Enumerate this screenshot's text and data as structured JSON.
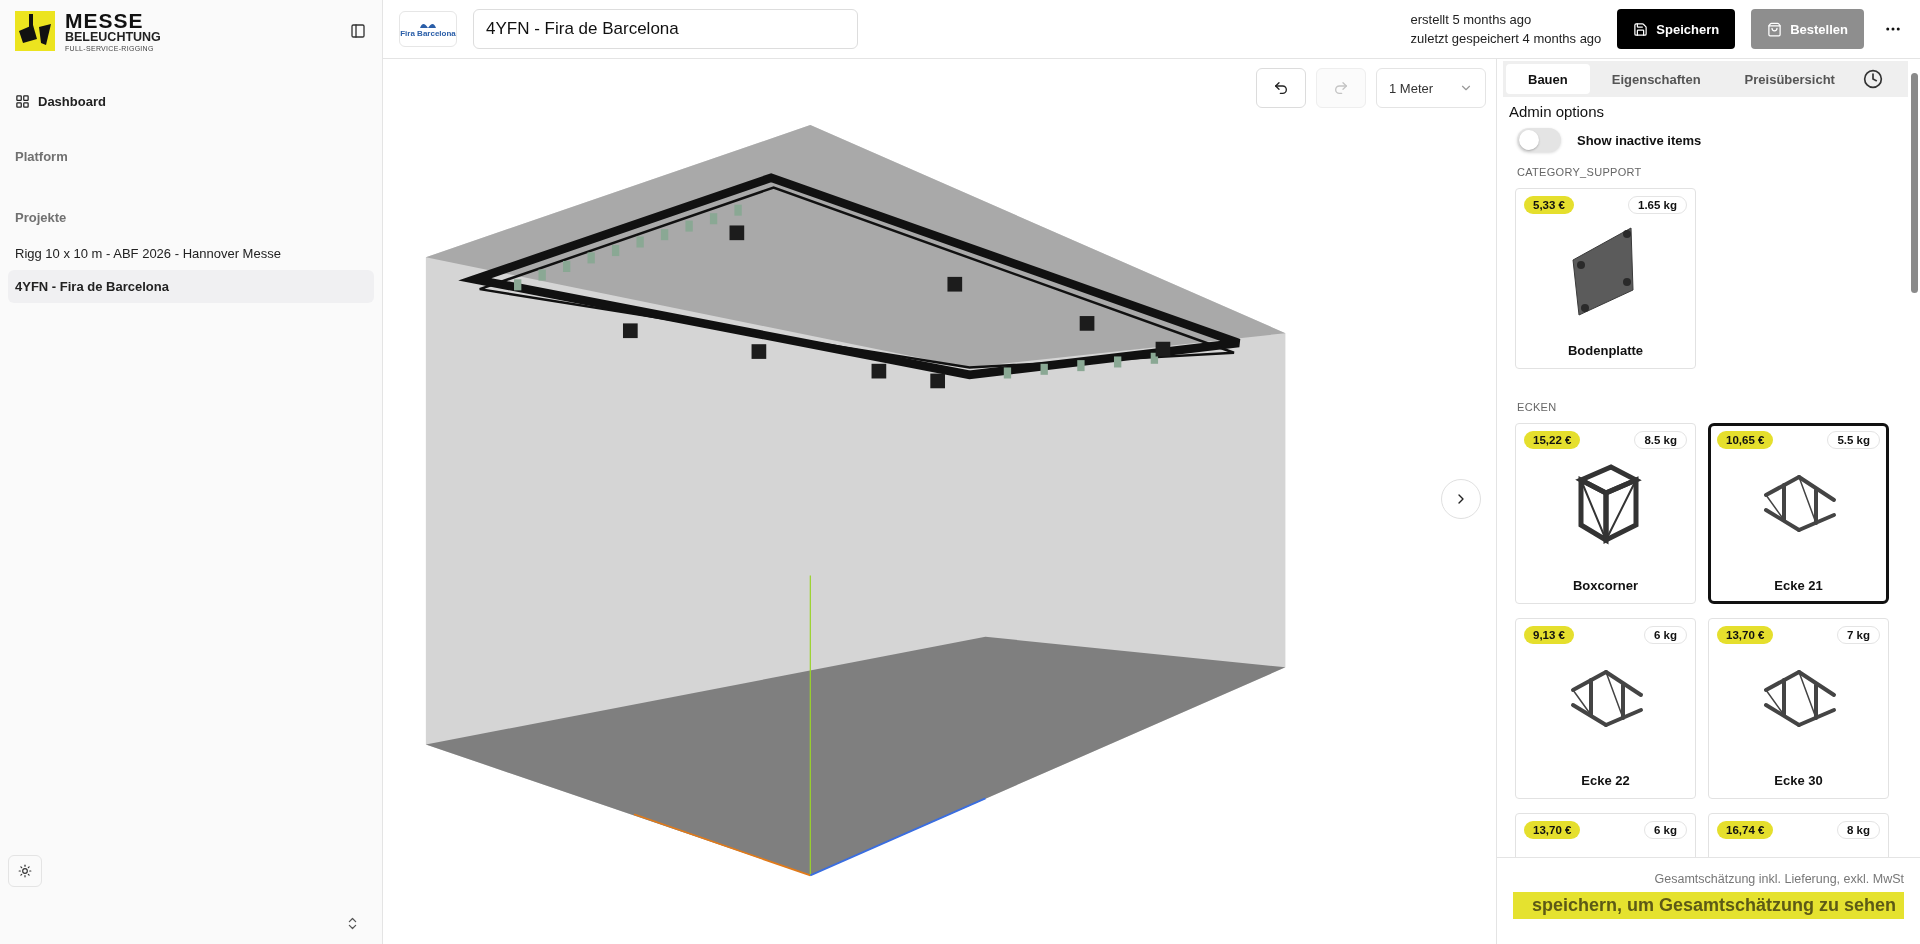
{
  "sidebar": {
    "logo": {
      "title": "MESSE",
      "subtitle": "BELEUCHTUNG",
      "tagline": "FULL-SERVICE-RIGGING"
    },
    "nav": [
      {
        "label": "Dashboard"
      }
    ],
    "sections": [
      {
        "label": "Platform"
      },
      {
        "label": "Projekte",
        "projects": [
          {
            "label": "Rigg 10 x 10 m - ABF 2026 - Hannover Messe",
            "selected": false
          },
          {
            "label": "4YFN - Fira de Barcelona",
            "selected": true
          }
        ]
      }
    ]
  },
  "header": {
    "client_logo": "Fira Barcelona",
    "project_name": "4YFN - Fira de Barcelona",
    "created": "erstellt 5 months ago",
    "saved": "zuletzt gespeichert 4 months ago",
    "buttons": [
      {
        "label": "Speichern",
        "kind": "save",
        "disabled": false
      },
      {
        "label": "Bestellen",
        "kind": "order",
        "disabled": true
      }
    ]
  },
  "viewport": {
    "tools": [
      {
        "kind": "undo",
        "disabled": false
      },
      {
        "kind": "redo",
        "disabled": true
      }
    ],
    "grid_size": "1 Meter"
  },
  "panel": {
    "tabs": [
      {
        "label": "Bauen",
        "selected": true
      },
      {
        "label": "Eigenschaften",
        "selected": false
      },
      {
        "label": "Preisübersicht",
        "selected": false
      }
    ],
    "admin": {
      "title": "Admin options",
      "toggle": {
        "label": "Show inactive items",
        "on": false
      }
    },
    "categories": [
      {
        "name": "CATEGORY_SUPPORT",
        "products": [
          {
            "price": "5,33 €",
            "weight": "1.65 kg",
            "name": "Bodenplatte",
            "kind": "plate",
            "selected": false
          }
        ]
      },
      {
        "name": "ECKEN",
        "products": [
          {
            "price": "15,22 €",
            "weight": "8.5 kg",
            "name": "Boxcorner",
            "kind": "box",
            "selected": false
          },
          {
            "price": "10,65 €",
            "weight": "5.5 kg",
            "name": "Ecke 21",
            "kind": "corner",
            "selected": true
          },
          {
            "price": "9,13 €",
            "weight": "6 kg",
            "name": "Ecke 22",
            "kind": "corner",
            "selected": false
          },
          {
            "price": "13,70 €",
            "weight": "7 kg",
            "name": "Ecke 30",
            "kind": "corner",
            "selected": false
          },
          {
            "price": "13,70 €",
            "weight": "6 kg",
            "selected": false
          },
          {
            "price": "16,74 €",
            "weight": "8 kg",
            "selected": false
          }
        ]
      }
    ],
    "footer": {
      "note": "Gesamtschätzung inkl. Lieferung, exkl. MwSt",
      "total": "speichern, um Gesamtschätzung zu sehen"
    }
  }
}
